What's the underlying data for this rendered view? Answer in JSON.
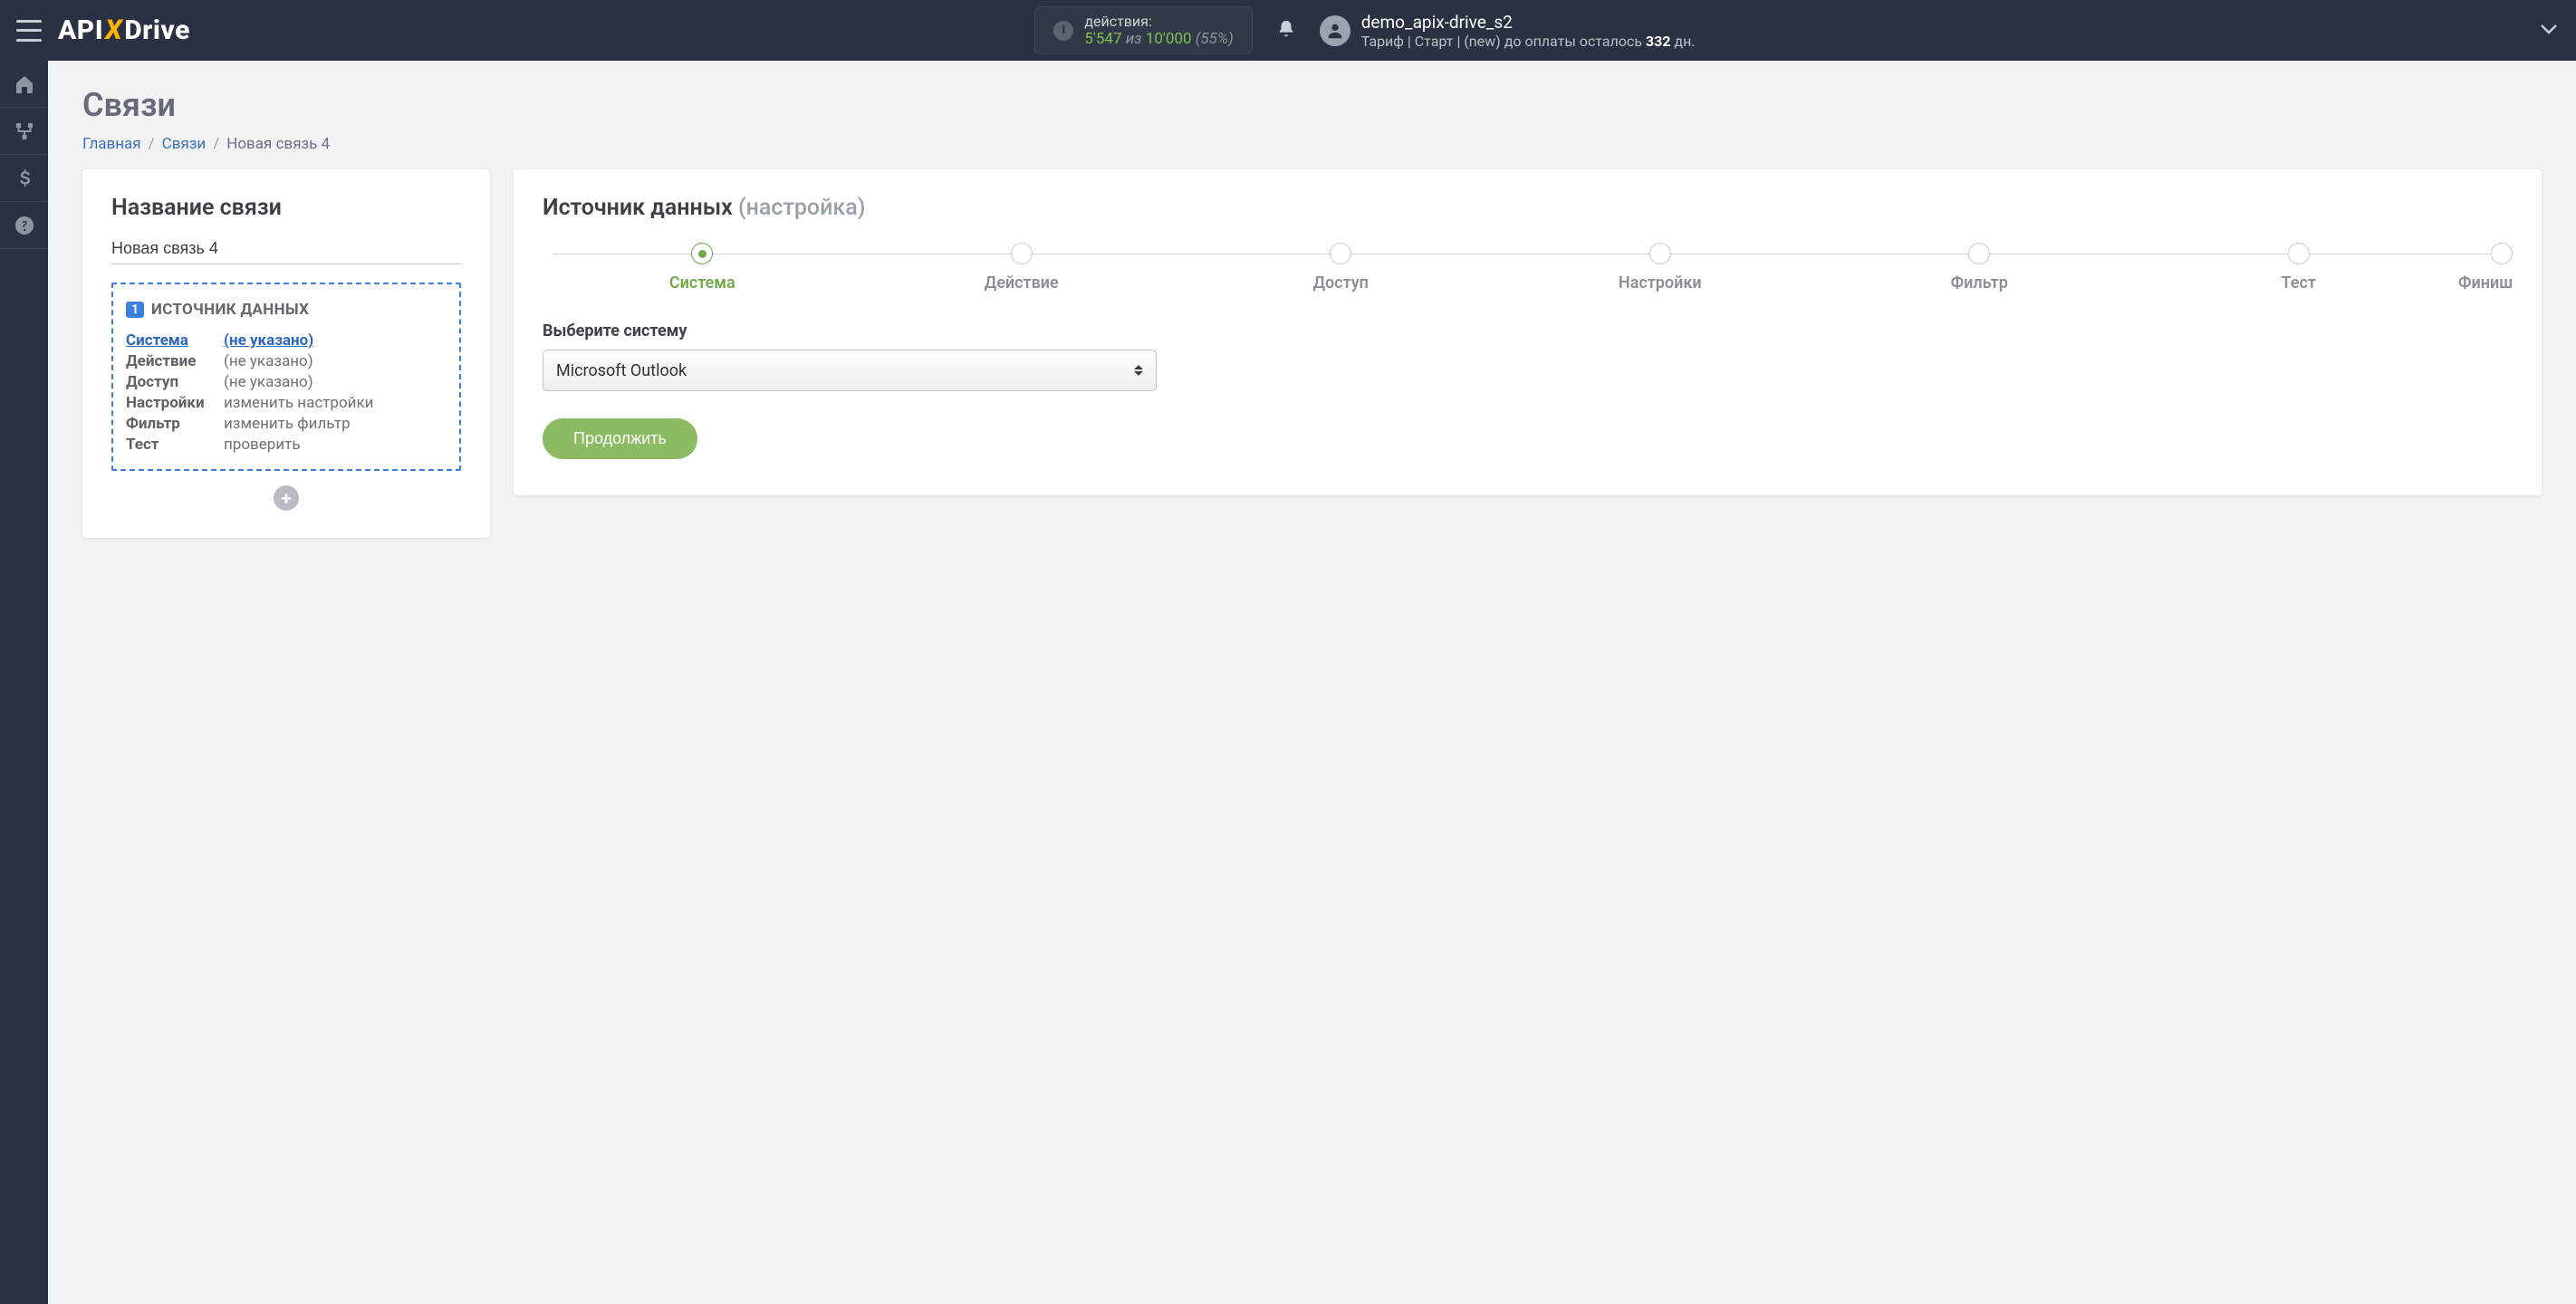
{
  "header": {
    "actions_label": "действия:",
    "actions_used": "5'547",
    "actions_of": " из ",
    "actions_limit": "10'000",
    "actions_pct": " (55%)",
    "username": "demo_apix-drive_s2",
    "tariff_prefix": "Тариф | Старт | (new) до оплаты осталось ",
    "tariff_days": "332",
    "tariff_suffix": " дн."
  },
  "page": {
    "title": "Связи",
    "crumbs": {
      "home": "Главная",
      "links": "Связи",
      "current": "Новая связь 4"
    }
  },
  "left": {
    "title": "Название связи",
    "name_value": "Новая связь 4",
    "block_num": "1",
    "block_title": "ИСТОЧНИК ДАННЫХ",
    "rows": [
      {
        "k": "Система",
        "v": "(не указано)",
        "cur": true
      },
      {
        "k": "Действие",
        "v": "(не указано)"
      },
      {
        "k": "Доступ",
        "v": "(не указано)"
      },
      {
        "k": "Настройки",
        "v": "изменить настройки"
      },
      {
        "k": "Фильтр",
        "v": "изменить фильтр"
      },
      {
        "k": "Тест",
        "v": "проверить"
      }
    ]
  },
  "right": {
    "title": "Источник данных ",
    "title_grey": "(настройка)",
    "steps": [
      "Система",
      "Действие",
      "Доступ",
      "Настройки",
      "Фильтр",
      "Тест",
      "Финиш"
    ],
    "active_step": 0,
    "field_label": "Выберите систему",
    "select_value": "Microsoft Outlook",
    "continue": "Продолжить"
  }
}
